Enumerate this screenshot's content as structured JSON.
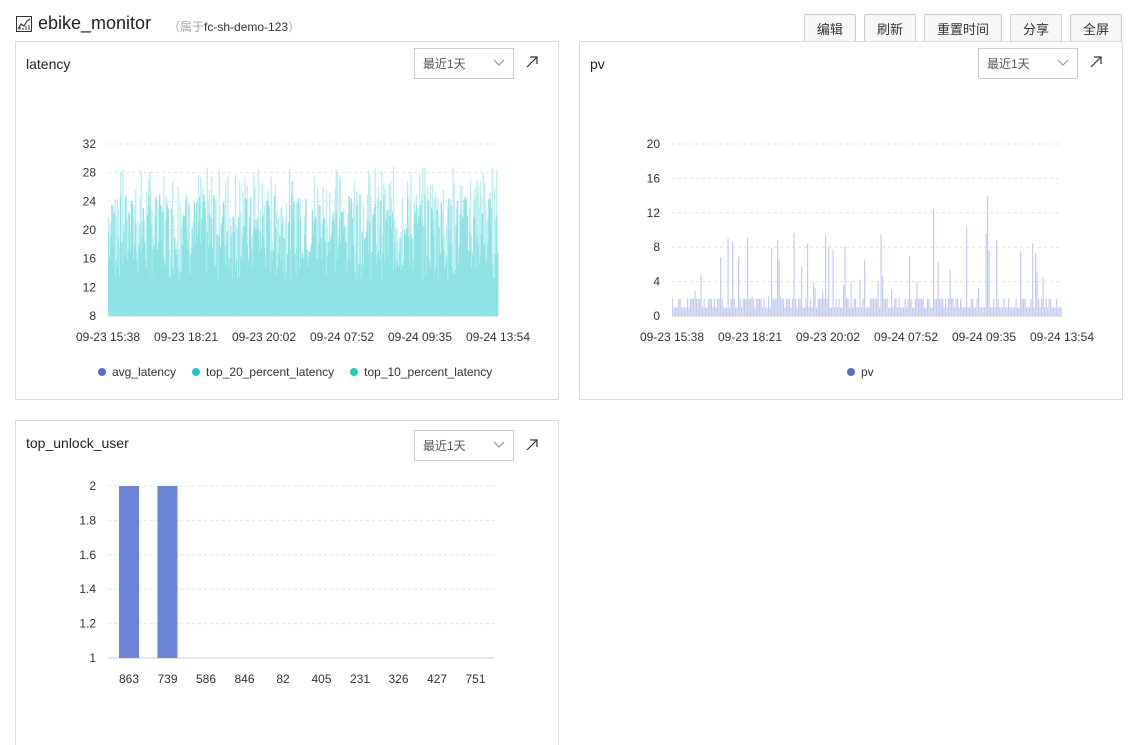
{
  "header": {
    "title": "ebike_monitor",
    "owner_prefix": "（属于",
    "owner_name": "fc-sh-demo-123",
    "owner_suffix": "）",
    "buttons": [
      "编辑",
      "刷新",
      "重置时间",
      "分享",
      "全屏"
    ]
  },
  "icons": {
    "title": "line-chart-icon",
    "select": "chevron-down-icon",
    "expand": "expand-arrow-icon"
  },
  "panels": {
    "latency": {
      "title": "latency",
      "range": "最近1天"
    },
    "pv": {
      "title": "pv",
      "range": "最近1天"
    },
    "top_unlock_user": {
      "title": "top_unlock_user",
      "range": "最近1天"
    }
  },
  "chart_data": [
    {
      "type": "area",
      "title": "latency",
      "x_ticks": [
        "09-23 15:38",
        "09-23 18:21",
        "09-23 20:02",
        "09-24 07:52",
        "09-24 09:35",
        "09-24 13:54"
      ],
      "ylim": [
        8,
        32
      ],
      "y_ticks": [
        8,
        12,
        16,
        20,
        24,
        28,
        32
      ],
      "grid": true,
      "legend_position": "bottom",
      "series": [
        {
          "name": "avg_latency",
          "color": "#5470c6",
          "values": []
        },
        {
          "name": "top_20_percent_latency",
          "color": "#1bc4cf",
          "values": []
        },
        {
          "name": "top_10_percent_latency",
          "color": "#1fd1b2",
          "values": []
        }
      ]
    },
    {
      "type": "bar",
      "title": "pv",
      "x_ticks": [
        "09-23 15:38",
        "09-23 18:21",
        "09-23 20:02",
        "09-24 07:52",
        "09-24 09:35",
        "09-24 13:54"
      ],
      "ylim": [
        0,
        20
      ],
      "y_ticks": [
        0,
        4,
        8,
        12,
        16,
        20
      ],
      "grid": true,
      "legend_position": "bottom",
      "series": [
        {
          "name": "pv",
          "color": "#5470c6",
          "values": []
        }
      ]
    },
    {
      "type": "bar",
      "title": "top_unlock_user",
      "categories": [
        "863",
        "739",
        "586",
        "846",
        "82",
        "405",
        "231",
        "326",
        "427",
        "751"
      ],
      "values": [
        2,
        2,
        1,
        1,
        1,
        1,
        1,
        1,
        1,
        1
      ],
      "ylim": [
        1,
        2
      ],
      "y_ticks": [
        "1",
        "1.2",
        "1.4",
        "1.6",
        "1.8",
        "2"
      ],
      "grid": true,
      "color": "#6b84d8"
    }
  ]
}
